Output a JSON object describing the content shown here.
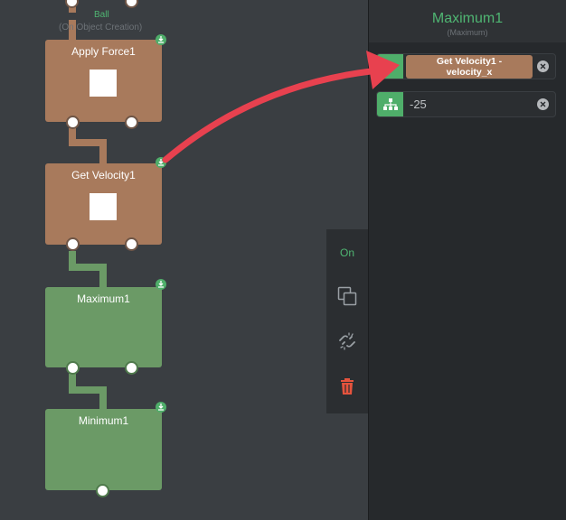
{
  "canvas": {
    "top_label": "Ball",
    "top_sublabel": "(On Object Creation)",
    "nodes": [
      {
        "title": "Apply Force1",
        "kind": "brown"
      },
      {
        "title": "Get Velocity1",
        "kind": "brown"
      },
      {
        "title": "Maximum1",
        "kind": "green"
      },
      {
        "title": "Minimum1",
        "kind": "green"
      }
    ]
  },
  "toolbar": {
    "on_label": "On",
    "icons": [
      "copy-icon",
      "unlink-icon",
      "trash-icon"
    ]
  },
  "panel": {
    "title": "Maximum1",
    "subtitle": "(Maximum)",
    "inputs": [
      {
        "chip_label": "Get Velocity1 - velocity_x",
        "icon": "link-icon"
      },
      {
        "value": "-25",
        "icon": "hierarchy-icon"
      }
    ]
  },
  "colors": {
    "accent_green": "#4fb572",
    "brown_node": "#a87a5c",
    "green_node": "#6b9a66",
    "arrow_red": "#e8414f",
    "trash_red": "#e5533d"
  }
}
